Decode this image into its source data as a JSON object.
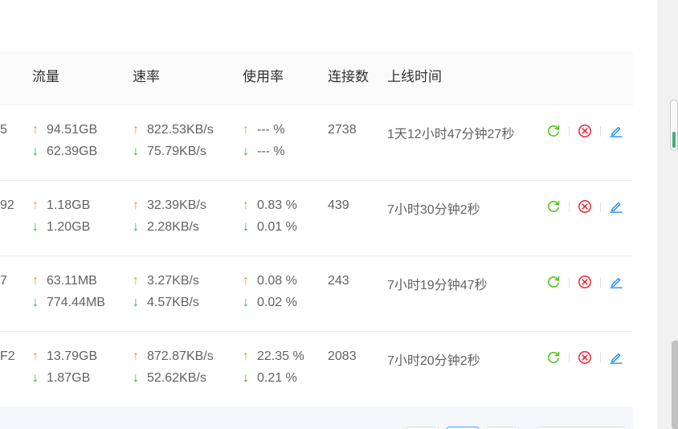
{
  "table": {
    "headers": {
      "traffic": "流量",
      "rate": "速率",
      "usage": "使用率",
      "connections": "连接数",
      "uptime": "上线时间"
    },
    "rows": [
      {
        "id_tail": "5",
        "traffic_up": "94.51GB",
        "traffic_down": "62.39GB",
        "rate_up": "822.53KB/s",
        "rate_down": "75.79KB/s",
        "usage_up": "--- %",
        "usage_down": "--- %",
        "connections": "2738",
        "uptime": "1天12小时47分钟27秒"
      },
      {
        "id_tail": "92",
        "traffic_up": "1.18GB",
        "traffic_down": "1.20GB",
        "rate_up": "32.39KB/s",
        "rate_down": "2.28KB/s",
        "usage_up": "0.83 %",
        "usage_down": "0.01 %",
        "connections": "439",
        "uptime": "7小时30分钟2秒"
      },
      {
        "id_tail": "7",
        "traffic_up": "63.11MB",
        "traffic_down": "774.44MB",
        "rate_up": "3.27KB/s",
        "rate_down": "4.57KB/s",
        "usage_up": "0.08 %",
        "usage_down": "0.02 %",
        "connections": "243",
        "uptime": "7小时19分钟47秒"
      },
      {
        "id_tail": "F2",
        "traffic_up": "13.79GB",
        "traffic_down": "1.87GB",
        "rate_up": "872.87KB/s",
        "rate_down": "52.62KB/s",
        "usage_up": "22.35 %",
        "usage_down": "0.21 %",
        "connections": "2083",
        "uptime": "7小时20分钟2秒"
      }
    ]
  },
  "glyphs": {
    "up_arrow": "↑",
    "down_arrow": "↓"
  },
  "colors": {
    "upload": "#ff8c1a",
    "download": "#28a745",
    "refresh": "#52c41a",
    "close": "#f5222d",
    "edit": "#1890ff"
  },
  "icons": [
    "refresh-icon",
    "close-circle-icon",
    "edit-icon"
  ],
  "pagination": {
    "active_index": 1
  }
}
